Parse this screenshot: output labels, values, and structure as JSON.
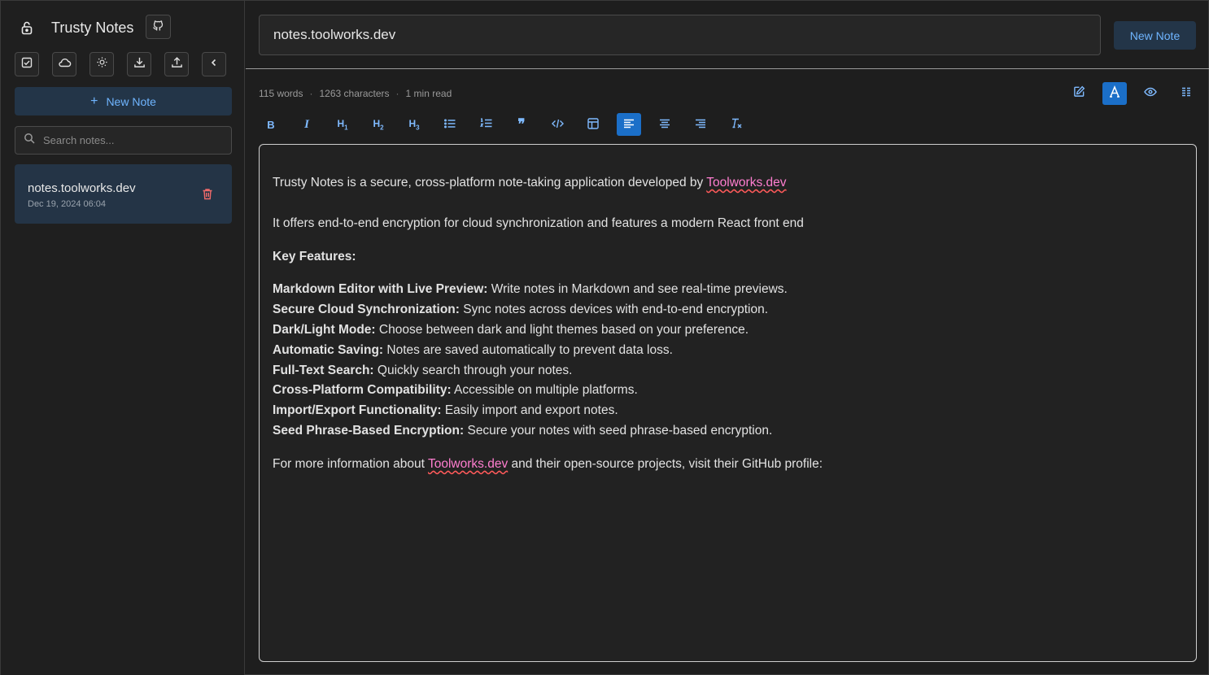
{
  "app": {
    "title": "Trusty Notes"
  },
  "sidebar": {
    "new_note_label": "New Note",
    "search_placeholder": "Search notes...",
    "notes": [
      {
        "title": "notes.toolworks.dev",
        "date": "Dec 19, 2024 06:04"
      }
    ]
  },
  "header": {
    "note_title_value": "notes.toolworks.dev",
    "new_note_label": "New Note"
  },
  "stats": {
    "words": "115 words",
    "characters": "1263 characters",
    "read": "1 min read"
  },
  "content": {
    "p1_text": "Trusty Notes is a secure, cross-platform note-taking application developed by ",
    "p1_link": "Toolworks.dev",
    "p2": "It offers end-to-end encryption for cloud synchronization and features a modern React front end",
    "key_heading": "Key Features:",
    "features": [
      {
        "label": "Markdown Editor with Live Preview:",
        "text": " Write notes in Markdown and see real-time previews."
      },
      {
        "label": "Secure Cloud Synchronization:",
        "text": " Sync notes across devices with end-to-end encryption."
      },
      {
        "label": "Dark/Light Mode:",
        "text": " Choose between dark and light themes based on your preference."
      },
      {
        "label": "Automatic Saving:",
        "text": " Notes are saved automatically to prevent data loss."
      },
      {
        "label": "Full-Text Search:",
        "text": " Quickly search through your notes."
      },
      {
        "label": "Cross-Platform Compatibility:",
        "text": " Accessible on multiple platforms."
      },
      {
        "label": "Import/Export Functionality:",
        "text": " Easily import and export notes."
      },
      {
        "label": "Seed Phrase-Based Encryption:",
        "text": " Secure your notes with seed phrase-based encryption."
      }
    ],
    "last_pre": "For more information about ",
    "last_link": "Toolworks.dev",
    "last_post": " and their open-source projects, visit their GitHub profile:"
  },
  "colors": {
    "accent": "#1b6fc8",
    "accent_text": "#6fb5ff",
    "link": "#ff7ed0",
    "background": "#1e1e1e"
  }
}
